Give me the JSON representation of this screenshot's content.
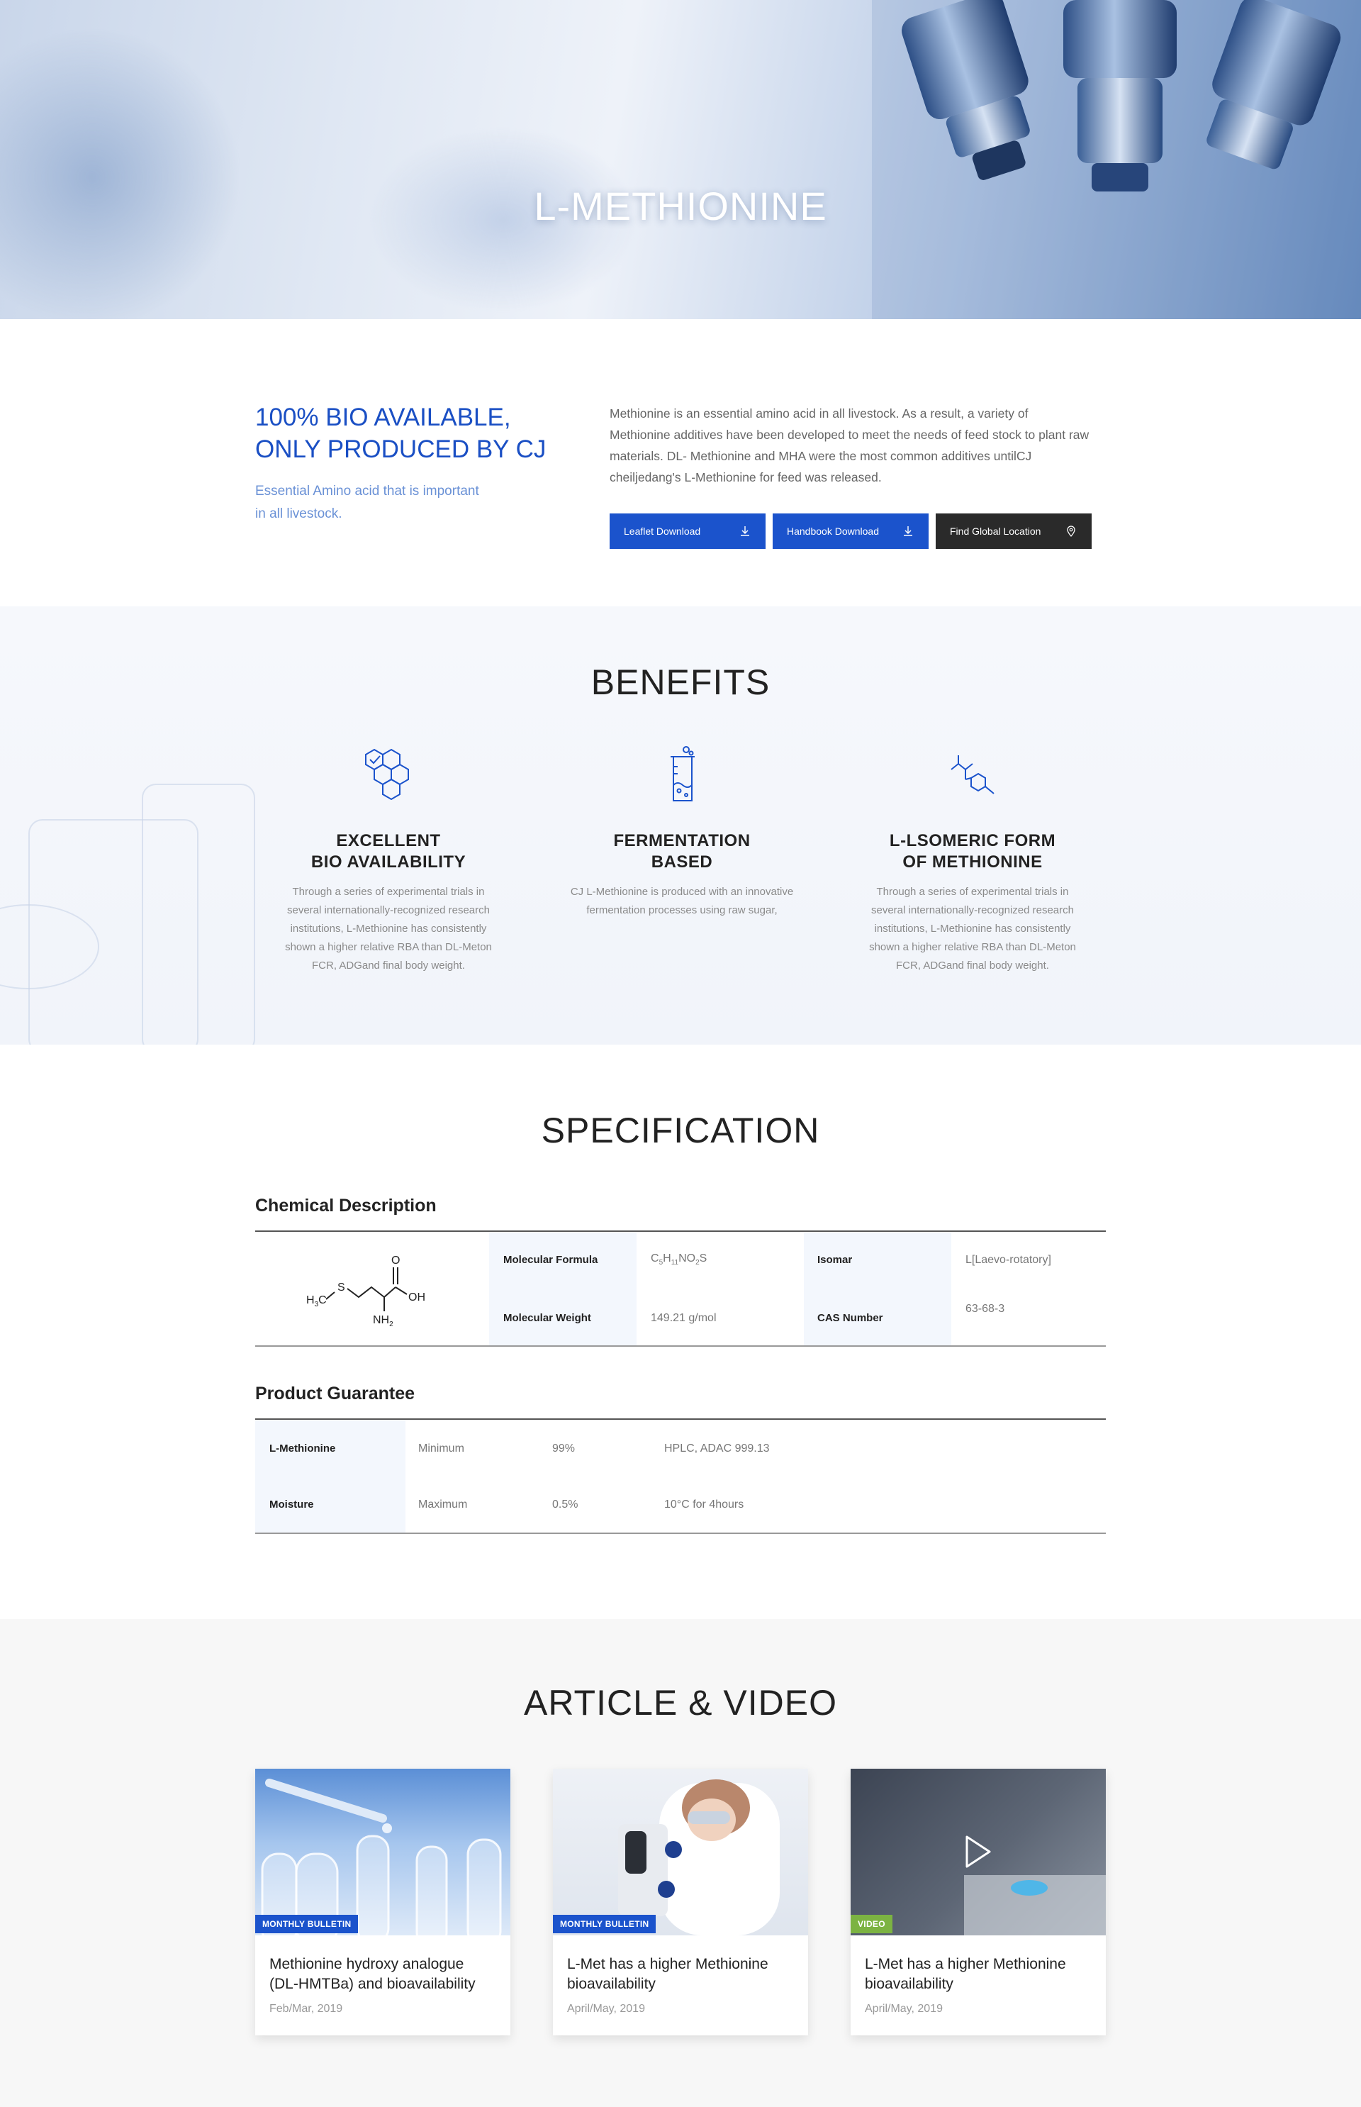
{
  "hero": {
    "title": "L-METHIONINE"
  },
  "intro": {
    "heading_line1": "100% BIO AVAILABLE,",
    "heading_line2": "ONLY PRODUCED BY CJ",
    "sub_line1": "Essential Amino acid that is important",
    "sub_line2": "in all livestock.",
    "text": "Methionine is an essential amino acid in all livestock. As a result, a variety of Methionine additives have been developed to meet the needs of feed stock to plant raw materials. DL- Methionine and MHA were the most common additives untilCJ cheiljedang's L-Methionine for feed was released.",
    "buttons": {
      "leaflet": "Leaflet Download",
      "handbook": "Handbook Download",
      "location": "Find Global Location"
    }
  },
  "benefits": {
    "title": "BENEFITS",
    "items": [
      {
        "icon": "hexagon-check-icon",
        "title_line1": "EXCELLENT",
        "title_line2": "BIO AVAILABILITY",
        "text": "Through a series of experimental trials in several internationally-recognized research institutions, L-Methionine has consistently shown a higher relative RBA than DL-Meton FCR, ADGand final body weight."
      },
      {
        "icon": "beaker-icon",
        "title_line1": "FERMENTATION",
        "title_line2": "BASED",
        "text": "CJ L-Methionine is produced with an innovative fermentation processes using raw sugar,"
      },
      {
        "icon": "molecule-icon",
        "title_line1": "L-LSOMERIC FORM",
        "title_line2": "OF METHIONINE",
        "text": "Through a series of experimental trials in several internationally-recognized research institutions, L-Methionine has consistently shown a higher relative RBA than DL-Meton FCR, ADGand final body weight."
      }
    ]
  },
  "specification": {
    "title": "SPECIFICATION",
    "chemical": {
      "title": "Chemical Description",
      "structure_labels": {
        "h3c": "H",
        "h3c_sub": "3",
        "h3c_c": "C",
        "s": "S",
        "o": "O",
        "oh": "OH",
        "nh": "NH",
        "nh_sub": "2"
      },
      "molecular_formula_label": "Molecular Formula",
      "molecular_formula": {
        "c": "C",
        "c_n": "5",
        "h": "H",
        "h_n": "11",
        "no": "NO",
        "no_n": "2",
        "s": "S"
      },
      "isomar_label": "Isomar",
      "isomar_value": "L[Laevo-rotatory]",
      "molecular_weight_label": "Molecular Weight",
      "molecular_weight_value": "149.21 g/mol",
      "cas_label": "CAS Number",
      "cas_value": "63-68-3"
    },
    "guarantee": {
      "title": "Product Guarantee",
      "rows": [
        {
          "name": "L-Methionine",
          "limit": "Minimum",
          "value": "99%",
          "method": "HPLC, ADAC 999.13"
        },
        {
          "name": "Moisture",
          "limit": "Maximum",
          "value": "0.5%",
          "method": "10°C for 4hours"
        }
      ]
    }
  },
  "articles": {
    "title": "ARTICLE & VIDEO",
    "cards": [
      {
        "badge": "MONTHLY BULLETIN",
        "badge_color": "#1b53cc",
        "title": "Methionine hydroxy analogue (DL-HMTBa) and bioavailability",
        "date": "Feb/Mar, 2019"
      },
      {
        "badge": "MONTHLY BULLETIN",
        "badge_color": "#1b53cc",
        "title": "L-Met has a higher Methionine bioavailability",
        "date": "April/May, 2019"
      },
      {
        "badge": "VIDEO",
        "badge_color": "#7cb342",
        "title": "L-Met has a higher Methionine bioavailability",
        "date": "April/May, 2019"
      }
    ]
  },
  "colors": {
    "brand_blue": "#1b53cc",
    "dark": "#2a2a2a",
    "video_green": "#7cb342"
  }
}
